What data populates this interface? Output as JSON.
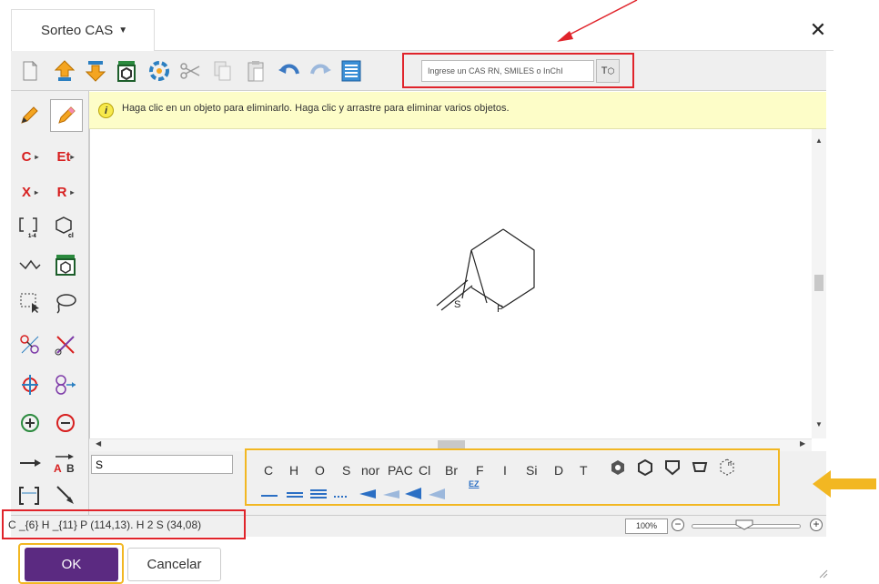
{
  "dialog": {
    "title": "Sorteo CAS",
    "close_label": "✕"
  },
  "toolbar": {
    "search_placeholder": "Ingrese un CAS RN, SMILES o InChI",
    "search_button_label": "T",
    "icons": [
      "new-document-icon",
      "import-icon",
      "export-icon",
      "template-icon",
      "orbit-icon",
      "cut-icon",
      "copy-icon",
      "paste-icon",
      "undo-icon",
      "redo-icon",
      "list-icon"
    ]
  },
  "info_bar": {
    "icon": "i",
    "message": "Haga clic en un objeto para eliminarlo. Haga clic y arrastre para eliminar varios objetos."
  },
  "left_tools": {
    "carbon_label": "C",
    "ethyl_label": "Et",
    "halogen_label": "X",
    "rgroup_label": "R",
    "repeat_label": "1-4"
  },
  "molecule": {
    "atoms": [
      "S",
      "P"
    ]
  },
  "bottom": {
    "atom_input_value": "S",
    "palette_elements": [
      "C",
      "H",
      "O",
      "S",
      "nor",
      "PAC",
      "Cl",
      "Br",
      "F",
      "I",
      "Si",
      "D",
      "T"
    ],
    "bond_label": "EZ"
  },
  "status": {
    "formula": "C _{6} H _{11} P (114,13). H 2 S (34,08)",
    "zoom": "100%",
    "zoom_minus": "−",
    "zoom_plus": "+"
  },
  "buttons": {
    "ok": "OK",
    "cancel": "Cancelar"
  },
  "colors": {
    "ok_bg": "#5b2a81",
    "highlight_red": "#e0242b",
    "highlight_orange": "#f2b722",
    "info_bg": "#fdfdc8"
  }
}
